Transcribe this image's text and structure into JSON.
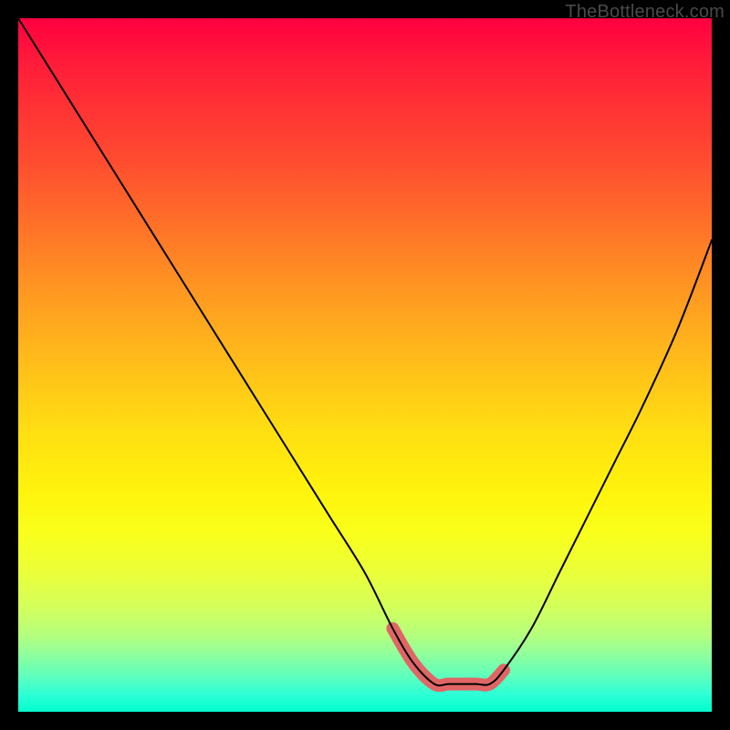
{
  "watermark": "TheBottleneck.com",
  "chart_data": {
    "type": "line",
    "title": "",
    "xlabel": "",
    "ylabel": "",
    "xlim": [
      0,
      100
    ],
    "ylim": [
      0,
      100
    ],
    "series": [
      {
        "name": "bottleneck-curve",
        "x": [
          0,
          5,
          10,
          15,
          20,
          25,
          30,
          35,
          40,
          45,
          50,
          54,
          57,
          60,
          62,
          64,
          66,
          68,
          70,
          74,
          78,
          82,
          86,
          90,
          95,
          100
        ],
        "values": [
          100,
          92,
          84,
          76,
          68,
          60,
          52,
          44,
          36,
          28,
          20,
          12,
          7,
          4,
          4,
          4,
          4,
          4,
          6,
          12,
          20,
          28,
          36,
          44,
          55,
          68
        ]
      },
      {
        "name": "highlight-band",
        "x": [
          54,
          57,
          60,
          62,
          64,
          66,
          68,
          70
        ],
        "values": [
          12,
          7,
          4,
          4,
          4,
          4,
          4,
          6
        ]
      }
    ],
    "background_gradient_stops": [
      {
        "pos": 0.0,
        "color": "#ff0040"
      },
      {
        "pos": 0.5,
        "color": "#ffc518"
      },
      {
        "pos": 0.74,
        "color": "#f9ff1a"
      },
      {
        "pos": 1.0,
        "color": "#00ffcc"
      }
    ],
    "highlight_color": "#e06666",
    "curve_color": "#000000"
  }
}
